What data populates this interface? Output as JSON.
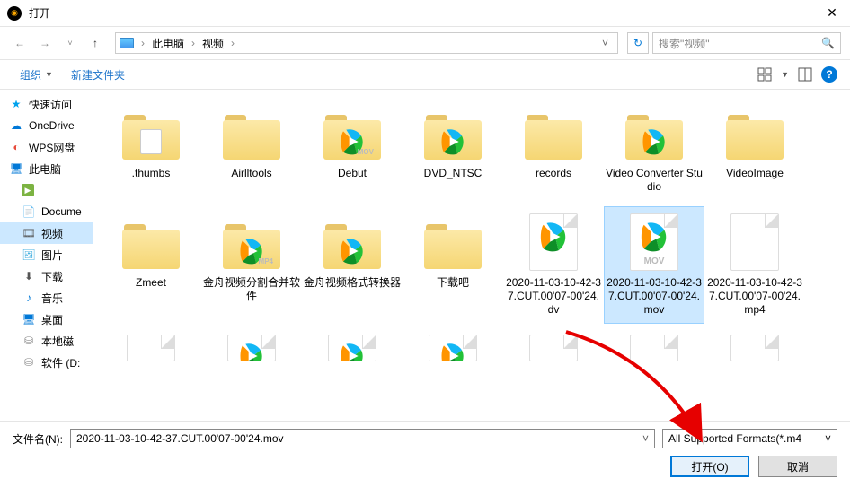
{
  "title": "打开",
  "breadcrumb": {
    "root": "此电脑",
    "current": "视频"
  },
  "search_placeholder": "搜索\"视频\"",
  "toolbar": {
    "organize": "组织",
    "newfolder": "新建文件夹"
  },
  "sidebar": {
    "items": [
      {
        "label": "快速访问",
        "icon": "star"
      },
      {
        "label": "OneDrive",
        "icon": "cloud"
      },
      {
        "label": "WPS网盘",
        "icon": "wps"
      },
      {
        "label": "此电脑",
        "icon": "pc"
      },
      {
        "label": "",
        "icon": "green"
      },
      {
        "label": "Docume",
        "icon": "doc"
      },
      {
        "label": "视频",
        "icon": "vid"
      },
      {
        "label": "图片",
        "icon": "img"
      },
      {
        "label": "下载",
        "icon": "dl"
      },
      {
        "label": "音乐",
        "icon": "music"
      },
      {
        "label": "桌面",
        "icon": "desk"
      },
      {
        "label": "本地磁",
        "icon": "disk"
      },
      {
        "label": "软件 (D:",
        "icon": "disk"
      }
    ]
  },
  "files": [
    {
      "label": ".thumbs",
      "kind": "folder-doc"
    },
    {
      "label": "Airlltools",
      "kind": "folder"
    },
    {
      "label": "Debut",
      "kind": "folder-tencent",
      "ext": "MOV"
    },
    {
      "label": "DVD_NTSC",
      "kind": "folder-tencent"
    },
    {
      "label": "records",
      "kind": "folder"
    },
    {
      "label": "Video Converter Studio",
      "kind": "folder-tencent"
    },
    {
      "label": "VideoImage",
      "kind": "folder"
    },
    {
      "label": "Zmeet",
      "kind": "folder"
    },
    {
      "label": "金舟视频分割合并软件",
      "kind": "folder-tencent",
      "ext": "MP4"
    },
    {
      "label": "金舟视频格式转换器",
      "kind": "folder-tencent"
    },
    {
      "label": "下载吧",
      "kind": "folder"
    },
    {
      "label": "2020-11-03-10-42-37.CUT.00'07-00'24.dv",
      "kind": "file-tencent"
    },
    {
      "label": "2020-11-03-10-42-37.CUT.00'07-00'24.mov",
      "kind": "file-tencent",
      "ext": "MOV",
      "selected": true
    },
    {
      "label": "2020-11-03-10-42-37.CUT.00'07-00'24.mp4",
      "kind": "file-blank"
    },
    {
      "label": "",
      "kind": "file-blank-half"
    },
    {
      "label": "",
      "kind": "file-tencent-half"
    },
    {
      "label": "",
      "kind": "file-tencent-half"
    },
    {
      "label": "",
      "kind": "file-tencent-half"
    },
    {
      "label": "",
      "kind": "file-blank-half"
    },
    {
      "label": "",
      "kind": "file-blank-half"
    },
    {
      "label": "",
      "kind": "file-blank-half"
    }
  ],
  "bottom": {
    "filename_label": "文件名(N):",
    "filename_value": "2020-11-03-10-42-37.CUT.00'07-00'24.mov",
    "filetype": "All Supported Formats(*.m4",
    "open": "打开(O)",
    "cancel": "取消"
  }
}
